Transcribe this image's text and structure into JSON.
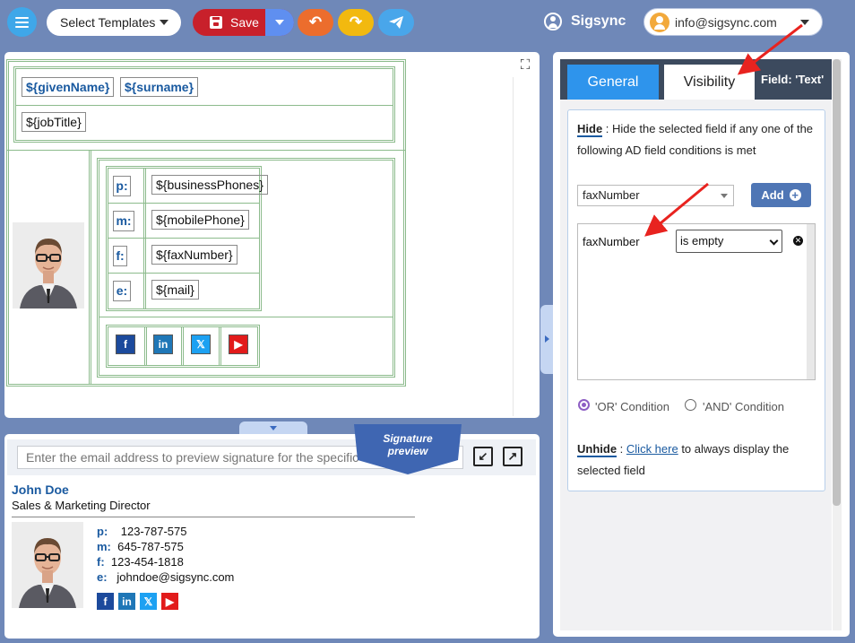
{
  "toolbar": {
    "templates_label": "Select Templates",
    "save_label": "Save",
    "brand": "Sigsync",
    "account_email": "info@sigsync.com"
  },
  "editor": {
    "given_name": "${givenName}",
    "surname": "${surname}",
    "job_title": "${jobTitle}",
    "contacts": [
      {
        "label": "p:",
        "value": "${businessPhones}"
      },
      {
        "label": "m:",
        "value": "${mobilePhone}"
      },
      {
        "label": "f:",
        "value": "${faxNumber}"
      },
      {
        "label": "e:",
        "value": "${mail}"
      }
    ],
    "social": [
      "f",
      "in",
      "𝕏",
      "▶"
    ]
  },
  "preview": {
    "placeholder": "Enter the email address to preview signature for the specific user",
    "ribbon_text": "Signature preview",
    "name": "John Doe",
    "title": "Sales & Marketing Director",
    "contacts": [
      {
        "label": "p:",
        "value": "123-787-575"
      },
      {
        "label": "m:",
        "value": "645-787-575"
      },
      {
        "label": "f:",
        "value": "123-454-1818"
      },
      {
        "label": "e:",
        "value": "johndoe@sigsync.com"
      }
    ]
  },
  "panel": {
    "tab_general": "General",
    "tab_visibility": "Visibility",
    "field_title": "Field: 'Text'",
    "hide_label": "Hide",
    "hide_text_1": " : Hide the selected field if any one of the",
    "hide_text_2": "following AD field conditions is met",
    "field_select": "faxNumber",
    "add_label": "Add",
    "condition_field": "faxNumber",
    "condition_operator": "is empty",
    "or_label": "'OR' Condition",
    "and_label": "'AND' Condition",
    "unhide_label": "Unhide",
    "unhide_sep": " : ",
    "unhide_link": "Click here",
    "unhide_text_1": " to always display the",
    "unhide_text_2": "selected field"
  },
  "colors": {
    "background": "#6f88b8",
    "save": "#c8202b",
    "accent_blue": "#2e94ec",
    "annotation_arrow": "#e8231f"
  }
}
